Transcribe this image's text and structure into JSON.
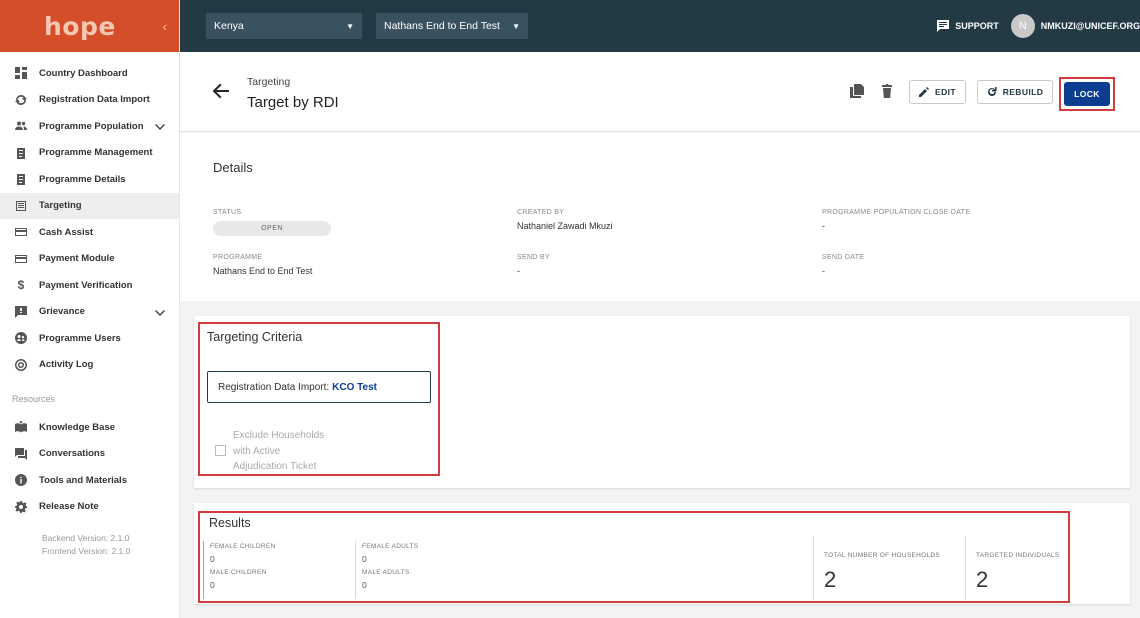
{
  "sidebar": {
    "logo": "hope",
    "collapse_icon": "chevron-left-icon",
    "items": [
      {
        "label": "Country Dashboard",
        "icon": "dashboard-icon"
      },
      {
        "label": "Registration Data Import",
        "icon": "refresh-icon"
      },
      {
        "label": "Programme Population",
        "icon": "people-icon",
        "expandable": true
      },
      {
        "label": "Programme Management",
        "icon": "clipboard-icon"
      },
      {
        "label": "Programme Details",
        "icon": "clipboard-icon"
      },
      {
        "label": "Targeting",
        "icon": "list-box-icon",
        "active": true
      },
      {
        "label": "Cash Assist",
        "icon": "card-icon"
      },
      {
        "label": "Payment Module",
        "icon": "card-icon"
      },
      {
        "label": "Payment Verification",
        "icon": "dollar-icon"
      },
      {
        "label": "Grievance",
        "icon": "feedback-icon",
        "expandable": true
      },
      {
        "label": "Programme Users",
        "icon": "users-circle-icon"
      },
      {
        "label": "Activity Log",
        "icon": "activity-icon"
      }
    ],
    "resources_label": "Resources",
    "resources": [
      {
        "label": "Knowledge Base",
        "icon": "book-icon"
      },
      {
        "label": "Conversations",
        "icon": "chat-icon"
      },
      {
        "label": "Tools and Materials",
        "icon": "info-icon"
      },
      {
        "label": "Release Note",
        "icon": "gear-icon"
      }
    ],
    "backend_version": "Backend Version: 2.1.0",
    "frontend_version": "Frontend Version: 2.1.0"
  },
  "topbar": {
    "country": "Kenya",
    "programme": "Nathans End to End Test",
    "support_label": "SUPPORT",
    "avatar_initial": "N",
    "user_email": "NMKUZI@UNICEF.ORG"
  },
  "header": {
    "breadcrumb": "Targeting",
    "title": "Target by RDI",
    "edit_label": "EDIT",
    "rebuild_label": "REBUILD",
    "lock_label": "LOCK"
  },
  "details": {
    "title": "Details",
    "status_label": "STATUS",
    "status_value": "OPEN",
    "created_by_label": "CREATED BY",
    "created_by_value": "Nathaniel Zawadi Mkuzi",
    "close_date_label": "PROGRAMME POPULATION CLOSE DATE",
    "close_date_value": "-",
    "programme_label": "PROGRAMME",
    "programme_value": "Nathans End to End Test",
    "send_by_label": "SEND BY",
    "send_by_value": "-",
    "send_date_label": "SEND DATE",
    "send_date_value": "-"
  },
  "criteria": {
    "title": "Targeting Criteria",
    "rdi_prefix": "Registration Data Import:",
    "rdi_name": "KCO Test",
    "exclude_label_1": "Exclude Households",
    "exclude_label_2": "with Active",
    "exclude_label_3": "Adjudication Ticket"
  },
  "results": {
    "title": "Results",
    "female_children_label": "FEMALE CHILDREN",
    "female_children_value": "0",
    "male_children_label": "MALE CHILDREN",
    "male_children_value": "0",
    "female_adults_label": "FEMALE ADULTS",
    "female_adults_value": "0",
    "male_adults_label": "MALE ADULTS",
    "male_adults_value": "0",
    "households_label": "TOTAL NUMBER OF HOUSEHOLDS",
    "households_value": "2",
    "individuals_label": "TARGETED INDIVIDUALS",
    "individuals_value": "2"
  },
  "colors": {
    "brand": "#d34e29",
    "topbar": "#233944",
    "primary": "#0b3d91",
    "highlight": "#d13b3b"
  }
}
